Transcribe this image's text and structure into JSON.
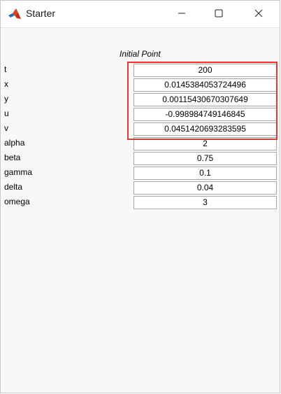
{
  "window": {
    "title": "Starter"
  },
  "icons": {
    "app": "matlab-icon",
    "minimize": "minimize-icon",
    "maximize": "maximize-icon",
    "close": "close-icon"
  },
  "form": {
    "heading": "Initial Point",
    "params": [
      {
        "label": "t",
        "value": "200"
      },
      {
        "label": "x",
        "value": "0.0145384053724496"
      },
      {
        "label": "y",
        "value": "0.00115430670307649"
      },
      {
        "label": "u",
        "value": "-0.998984749146845"
      },
      {
        "label": "v",
        "value": "0.0451420693283595"
      },
      {
        "label": "alpha",
        "value": "2"
      },
      {
        "label": "beta",
        "value": "0.75"
      },
      {
        "label": "gamma",
        "value": "0.1"
      },
      {
        "label": "delta",
        "value": "0.04"
      },
      {
        "label": "omega",
        "value": "3"
      }
    ]
  },
  "highlight_color": "#e53935"
}
